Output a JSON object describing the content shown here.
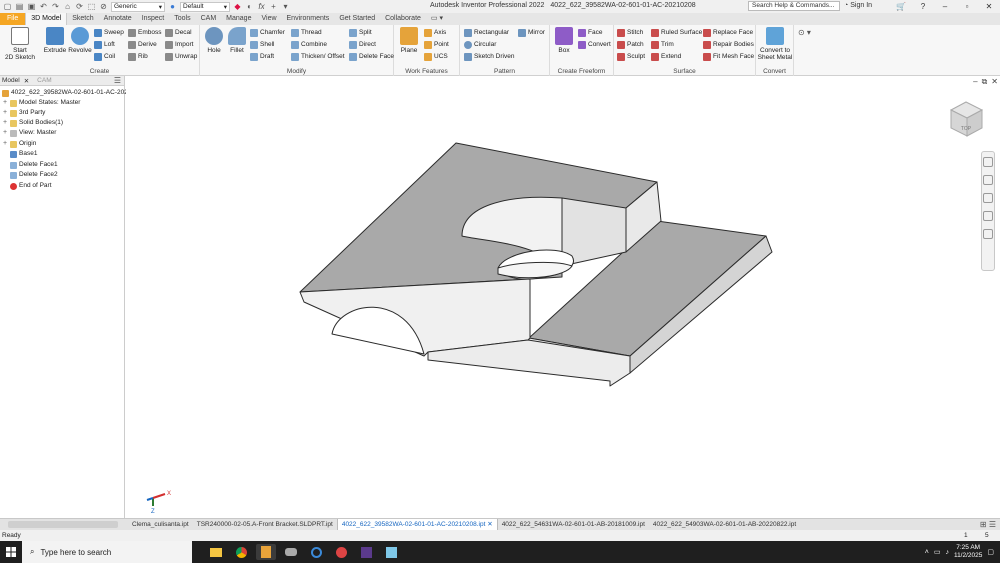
{
  "title_bar": {
    "app_title": "Autodesk Inventor Professional 2022",
    "doc_title": "4022_622_39582WA-02-601-01-AC-20210208",
    "appearance_value": "Generic",
    "material_value": "Default",
    "fx_label": "fx",
    "search_placeholder": "Search Help & Commands...",
    "signin_label": "Sign In"
  },
  "tabs": [
    "File",
    "3D Model",
    "Sketch",
    "Annotate",
    "Inspect",
    "Tools",
    "CAM",
    "Manage",
    "View",
    "Environments",
    "Get Started",
    "Collaborate"
  ],
  "ribbon": {
    "create": {
      "label": "Create",
      "start_sketch_1": "Start",
      "start_sketch_2": "2D Sketch",
      "extrude": "Extrude",
      "revolve": "Revolve",
      "sweep": "Sweep",
      "emboss": "Emboss",
      "decal": "Decal",
      "loft": "Loft",
      "derive": "Derive",
      "import": "Import",
      "coil": "Coil",
      "rib": "Rib",
      "unwrap": "Unwrap"
    },
    "modify": {
      "label": "Modify",
      "hole": "Hole",
      "fillet": "Fillet",
      "chamfer": "Chamfer",
      "thread": "Thread",
      "split": "Split",
      "shell": "Shell",
      "combine": "Combine",
      "direct": "Direct",
      "draft": "Draft",
      "thicken": "Thicken/ Offset",
      "delete_face": "Delete Face"
    },
    "work_features": {
      "label": "Work Features",
      "plane": "Plane",
      "axis": "Axis",
      "point": "Point",
      "ucs": "UCS"
    },
    "pattern": {
      "label": "Pattern",
      "rectangular": "Rectangular",
      "mirror": "Mirror",
      "circular": "Circular",
      "sketch_driven": "Sketch Driven"
    },
    "create_freeform": {
      "label": "Create Freeform",
      "box": "Box",
      "face": "Face",
      "convert": "Convert"
    },
    "surface": {
      "label": "Surface",
      "stitch": "Stitch",
      "ruled_surface": "Ruled Surface",
      "patch": "Patch",
      "trim": "Trim",
      "sculpt": "Sculpt",
      "extend": "Extend",
      "replace_face": "Replace Face",
      "repair_bodies": "Repair Bodies",
      "fit_mesh_face": "Fit Mesh Face"
    },
    "convert": {
      "label": "Convert",
      "to_sheet_metal_1": "Convert to",
      "to_sheet_metal_2": "Sheet Metal"
    }
  },
  "browser": {
    "tab_model": "Model",
    "tab_cam": "CAM",
    "root": "4022_622_39582WA-02-601-01-AC-2021020",
    "items": [
      {
        "label": "Model States: Master",
        "expand": "+"
      },
      {
        "label": "3rd Party",
        "expand": "+"
      },
      {
        "label": "Solid Bodies(1)",
        "expand": "+"
      },
      {
        "label": "View: Master",
        "expand": "+"
      },
      {
        "label": "Origin",
        "expand": "+"
      },
      {
        "label": "Base1",
        "expand": ""
      },
      {
        "label": "Delete Face1",
        "expand": ""
      },
      {
        "label": "Delete Face2",
        "expand": ""
      },
      {
        "label": "End of Part",
        "expand": ""
      }
    ]
  },
  "viewcube": {
    "face": "TOP"
  },
  "triad": {
    "x": "X",
    "z": "Z"
  },
  "doc_tabs": [
    {
      "label": "Clema_culisanta.ipt",
      "active": false
    },
    {
      "label": "TSR240000-02-05.A-Front Bracket.SLDPRT.ipt",
      "active": false
    },
    {
      "label": "4022_622_39582WA-02-601-01-AC-20210208.ipt",
      "active": true
    },
    {
      "label": "4022_622_54631WA-02-601-01-AB-20181009.ipt",
      "active": false
    },
    {
      "label": "4022_622_54903WA-02-601-01-AB-20220822.ipt",
      "active": false
    }
  ],
  "status": {
    "text": "Ready",
    "count1": "1",
    "count2": "5"
  },
  "taskbar": {
    "search_placeholder": "Type here to search",
    "time": "7:25 AM",
    "date": "11/2/2025"
  },
  "colors": {
    "file_tab": "#f5a623",
    "active_doc": "#1565c0",
    "taskbar": "#1f1f1f"
  }
}
